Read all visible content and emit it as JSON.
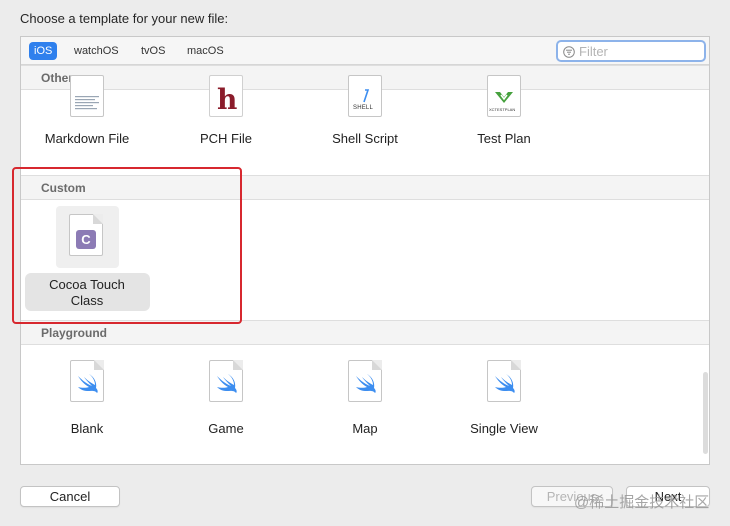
{
  "header": {
    "prompt": "Choose a template for your new file:"
  },
  "platform_tabs": [
    {
      "label": "iOS",
      "active": true
    },
    {
      "label": "watchOS",
      "active": false
    },
    {
      "label": "tvOS",
      "active": false
    },
    {
      "label": "macOS",
      "active": false
    }
  ],
  "filter": {
    "placeholder": "Filter",
    "icon": "filter-icon"
  },
  "sections": {
    "other": {
      "title": "Other",
      "items": [
        {
          "label": "Markdown File",
          "icon": "markdown-file-icon"
        },
        {
          "label": "PCH File",
          "icon": "pch-file-icon",
          "glyph": "h"
        },
        {
          "label": "Shell Script",
          "icon": "shell-script-icon",
          "glyph": "SHELL"
        },
        {
          "label": "Test Plan",
          "icon": "test-plan-icon",
          "glyph": "XCTESTPLAN"
        }
      ]
    },
    "custom": {
      "title": "Custom",
      "items": [
        {
          "label": "Cocoa Touch\nClass",
          "icon": "cocoa-touch-class-icon",
          "glyph": "C",
          "selected": true
        }
      ]
    },
    "playground": {
      "title": "Playground",
      "items": [
        {
          "label": "Blank",
          "icon": "swift-icon"
        },
        {
          "label": "Game",
          "icon": "swift-icon"
        },
        {
          "label": "Map",
          "icon": "swift-icon"
        },
        {
          "label": "Single View",
          "icon": "swift-icon"
        }
      ]
    }
  },
  "buttons": {
    "cancel": "Cancel",
    "previous": "Previous",
    "next": "Next"
  },
  "watermark": "@稀土掘金技术社区",
  "colors": {
    "accent": "#2f80ed",
    "highlight_border": "#d7282f",
    "swift_orange": "#3d8ef0",
    "pch_red": "#8b1c2b",
    "class_purple": "#8c7bb5"
  }
}
